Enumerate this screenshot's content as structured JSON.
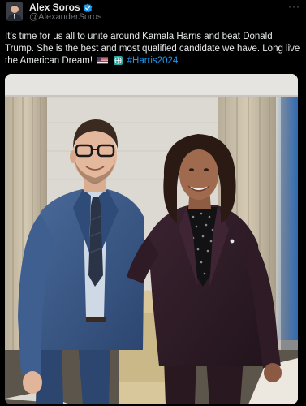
{
  "author": {
    "display_name": "Alex Soros",
    "handle": "@AlexanderSoros",
    "verified": true
  },
  "tweet": {
    "text": "It’s time for us all to unite around Kamala Harris and beat Donald Trump. She is the best and most qualified candidate we have. Long live the American Dream!",
    "emoji": [
      "us-flag-icon",
      "globe-icon"
    ],
    "hashtag": "#Harris2024"
  },
  "colors": {
    "background": "#000000",
    "text": "#e7e9ea",
    "secondary": "#71767b",
    "link": "#1d9bf0"
  }
}
